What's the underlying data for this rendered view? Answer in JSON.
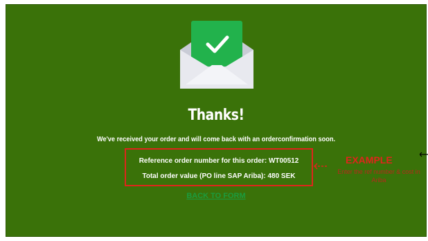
{
  "page": {
    "title": "Thanks!",
    "message": "We've received your order and will come back with an orderconfirmation soon.",
    "reference_line": "Reference order number for this order: WT00512",
    "total_line": "Total order value (PO line SAP Ariba): 480 SEK",
    "back_link": "BACK TO FORM"
  },
  "annotation": {
    "label": "EXAMPLE",
    "note": "Enter the ref number & cost in Ariba"
  },
  "icons": {
    "envelope": "envelope-check-icon"
  },
  "colors": {
    "background": "#3a7209",
    "highlight": "#e0251b",
    "link": "#1b9c3f",
    "check_card": "#22b24c"
  }
}
